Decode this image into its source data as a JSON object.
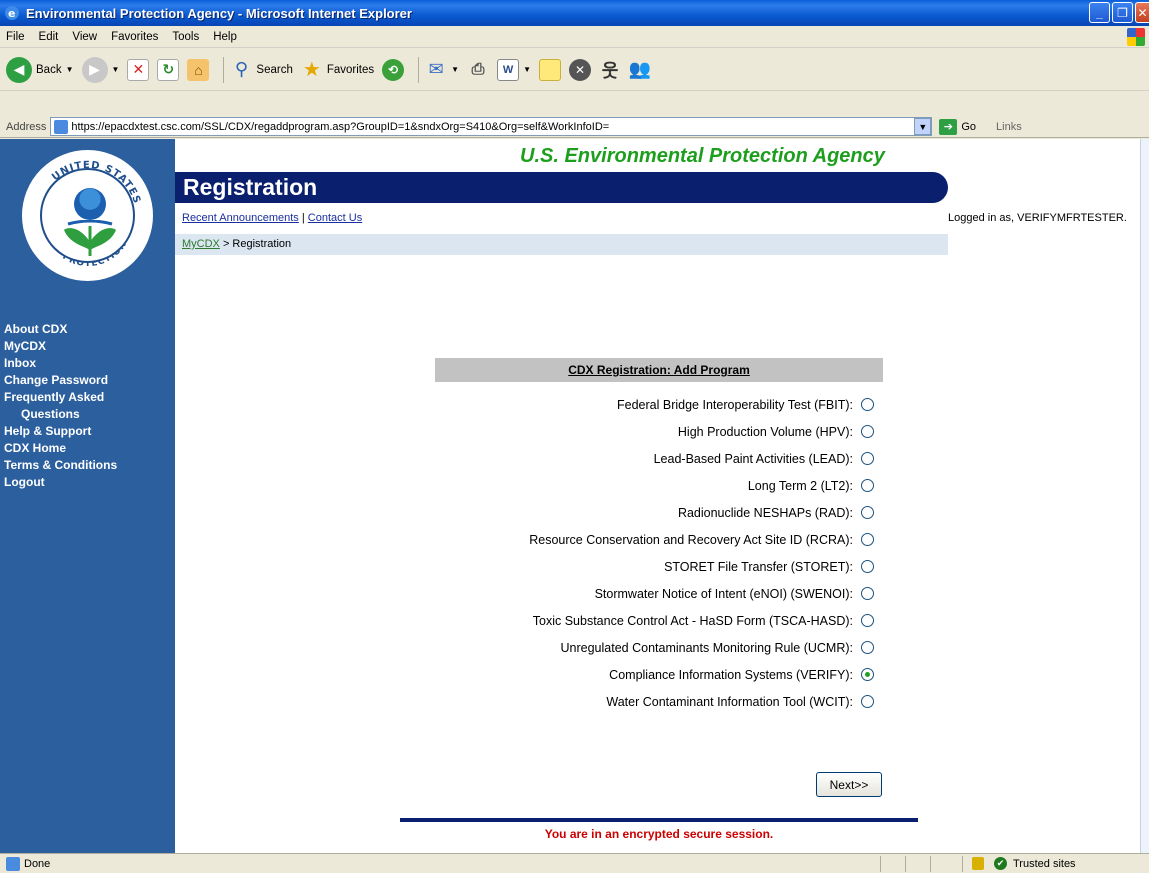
{
  "window": {
    "title": "Environmental Protection Agency - Microsoft Internet Explorer"
  },
  "menu": [
    "File",
    "Edit",
    "View",
    "Favorites",
    "Tools",
    "Help"
  ],
  "toolbar": {
    "back_label": "Back",
    "search_label": "Search",
    "favorites_label": "Favorites"
  },
  "address": {
    "label": "Address",
    "url": "https://epacdxtest.csc.com/SSL/CDX/regaddprogram.asp?GroupID=1&sndxOrg=S410&Org=self&WorkInfoID=",
    "go_label": "Go",
    "links_label": "Links"
  },
  "page": {
    "seal_top": "UNITED STATES",
    "seal_left": "ENVIRONMENTAL",
    "seal_bottom": "PROTECTION",
    "seal_right": "AGENCY",
    "agency_title": "U.S. Environmental Protection Agency",
    "banner_title": "Registration",
    "recent_announcements": "Recent Announcements",
    "link_sep": "|",
    "contact_us": "Contact Us",
    "logged_in": "Logged in as, VERIFYMFRTESTER.",
    "breadcrumb_link": "MyCDX",
    "breadcrumb_rest": " > Registration",
    "form_header": "CDX Registration: Add Program",
    "next_label": "Next>>",
    "secure_note": "You are in an encrypted secure session."
  },
  "sidebar": {
    "items": [
      {
        "label": "About CDX"
      },
      {
        "label": "MyCDX"
      },
      {
        "label": "Inbox"
      },
      {
        "label": "Change Password"
      },
      {
        "label": "Frequently Asked"
      },
      {
        "label": "Questions"
      },
      {
        "label": "Help & Support"
      },
      {
        "label": "CDX Home"
      },
      {
        "label": "Terms & Conditions"
      },
      {
        "label": "Logout"
      }
    ]
  },
  "programs": [
    {
      "label": "Federal Bridge Interoperability Test (FBIT):",
      "checked": false
    },
    {
      "label": "High Production Volume (HPV):",
      "checked": false
    },
    {
      "label": "Lead-Based Paint Activities (LEAD):",
      "checked": false
    },
    {
      "label": "Long Term 2 (LT2):",
      "checked": false
    },
    {
      "label": "Radionuclide NESHAPs (RAD):",
      "checked": false
    },
    {
      "label": "Resource Conservation and Recovery Act Site ID (RCRA):",
      "checked": false
    },
    {
      "label": "STORET File Transfer (STORET):",
      "checked": false
    },
    {
      "label": "Stormwater Notice of Intent (eNOI) (SWENOI):",
      "checked": false
    },
    {
      "label": "Toxic Substance Control Act - HaSD Form (TSCA-HASD):",
      "checked": false
    },
    {
      "label": "Unregulated Contaminants Monitoring Rule (UCMR):",
      "checked": false
    },
    {
      "label": "Compliance Information Systems (VERIFY):",
      "checked": true
    },
    {
      "label": "Water Contaminant Information Tool (WCIT):",
      "checked": false
    }
  ],
  "status": {
    "text": "Done",
    "zone": "Trusted sites"
  },
  "colors": {
    "title_bar": "#0A5FD8",
    "sidebar": "#2C5F9E",
    "banner": "#0A1F6E",
    "agency_green": "#1D9F1D",
    "secure_red": "#CC0000"
  }
}
